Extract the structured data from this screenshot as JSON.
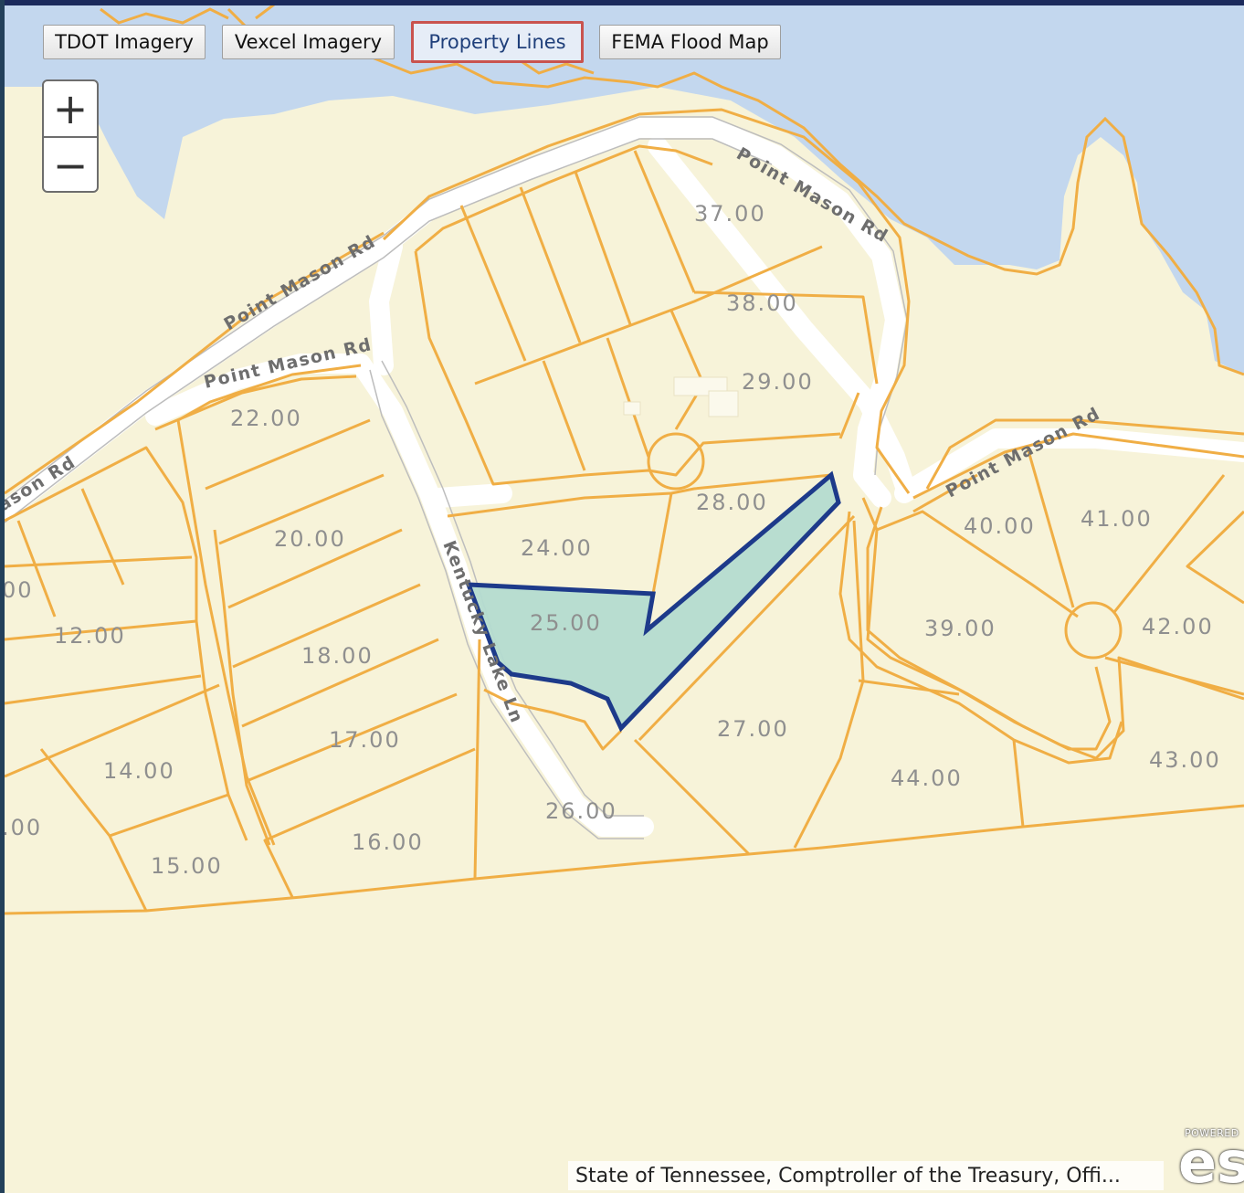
{
  "layer_buttons": [
    {
      "label": "TDOT Imagery",
      "active": false
    },
    {
      "label": "Vexcel Imagery",
      "active": false
    },
    {
      "label": "Property Lines",
      "active": true
    },
    {
      "label": "FEMA Flood Map",
      "active": false
    }
  ],
  "zoom": {
    "in_label": "+",
    "out_label": "−"
  },
  "roads": {
    "point_mason_1": "Point Mason Rd",
    "point_mason_2": "Point Mason Rd",
    "point_mason_3": "Point Mason Rd",
    "point_mason_4": "Point Mason Rd",
    "point_mason_5": "ason Rd",
    "kentucky_lake": "Kentucky Lake Ln"
  },
  "parcels": {
    "p37": "37.00",
    "p38": "38.00",
    "p29": "29.00",
    "p28": "28.00",
    "p22": "22.00",
    "p20": "20.00",
    "p24": "24.00",
    "p25": "25.00",
    "p18": "18.00",
    "p17": "17.00",
    "p16": "16.00",
    "p15": "15.00",
    "p14": "14.00",
    "p12": "12.00",
    "p_edge1": ".00",
    "p_edge2": "00",
    "p26": "26.00",
    "p27": "27.00",
    "p44": "44.00",
    "p43": "43.00",
    "p40": "40.00",
    "p41": "41.00",
    "p42": "42.00",
    "p39": "39.00"
  },
  "selected_parcel": "25.00",
  "attribution": "State of Tennessee, Comptroller of the Treasury, Offi...",
  "logo": {
    "powered_by": "POWERED",
    "brand": "esri"
  },
  "colors": {
    "land": "#f7f3d9",
    "water": "#c3d7ee",
    "parcel_line": "#f0ae45",
    "road": "#ffffff",
    "selected_fill": "#b4dbd0",
    "selected_stroke": "#1d3a8a",
    "active_button_border": "#c9534e"
  }
}
